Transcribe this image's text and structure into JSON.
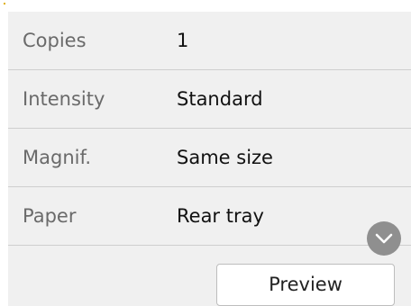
{
  "settings": {
    "rows": [
      {
        "label": "Copies",
        "value": "1"
      },
      {
        "label": "Intensity",
        "value": "Standard"
      },
      {
        "label": "Magnif.",
        "value": "Same size"
      },
      {
        "label": "Paper",
        "value": "Rear tray"
      }
    ]
  },
  "controls": {
    "scroll_icon": "chevron-down-icon",
    "preview_label": "Preview"
  },
  "colors": {
    "panel_background": "#f0f0f0",
    "label_text": "#6a6a6a",
    "value_text": "#111111",
    "scroll_button": "#8f8f8f",
    "button_background": "#ffffff"
  }
}
